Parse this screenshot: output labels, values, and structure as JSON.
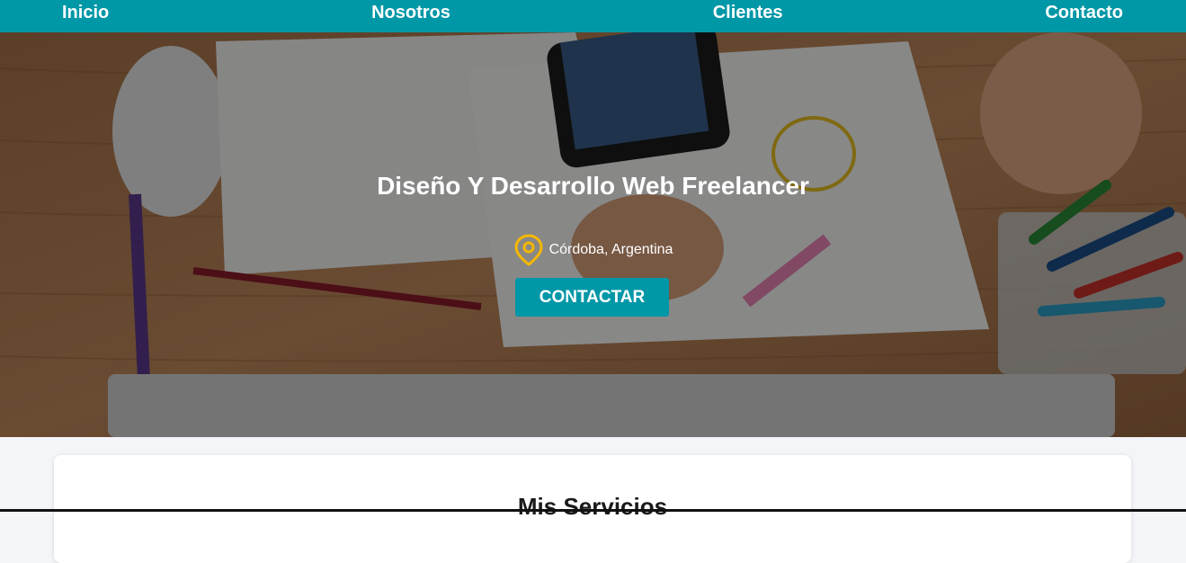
{
  "nav": {
    "items": [
      {
        "label": "Inicio"
      },
      {
        "label": "Nosotros"
      },
      {
        "label": "Clientes"
      },
      {
        "label": "Contacto"
      }
    ]
  },
  "hero": {
    "title": "Diseño Y Desarrollo Web Freelancer",
    "location": "Córdoba, Argentina",
    "location_icon": "map-pin-icon",
    "cta_label": "CONTACTAR"
  },
  "services": {
    "title": "Mis Servicios"
  },
  "colors": {
    "accent": "#0097a7",
    "pin": "#f5b800",
    "text_light": "#ffffff"
  }
}
